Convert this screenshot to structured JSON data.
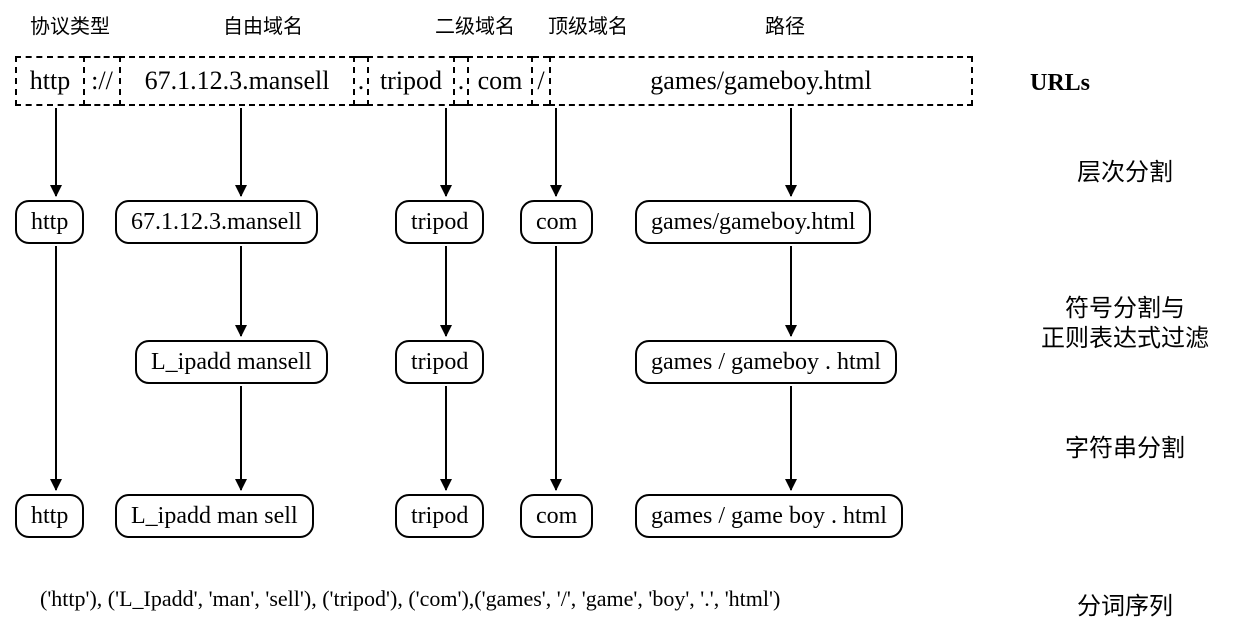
{
  "headers": {
    "protocol": "协议类型",
    "freedomain": "自由域名",
    "second": "二级域名",
    "top": "顶级域名",
    "path": "路径"
  },
  "url_parts": {
    "protocol": "http",
    "sep1": "://",
    "freedomain": "67.1.12.3.mansell",
    "sep2": ".",
    "second": "tripod",
    "sep3": ".",
    "top": "com",
    "sep4": "/",
    "path": "games/gameboy.html"
  },
  "sidebar": {
    "urls": "URLs",
    "level_split": "层次分割",
    "symbol_split_l1": "符号分割与",
    "symbol_split_l2": "正则表达式过滤",
    "string_split": "字符串分割",
    "token_seq": "分词序列"
  },
  "row1": {
    "c1": "http",
    "c2": "67.1.12.3.mansell",
    "c3": "tripod",
    "c4": "com",
    "c5": "games/gameboy.html"
  },
  "row2": {
    "c2": "L_ipadd  mansell",
    "c3": "tripod",
    "c5": "games / gameboy . html"
  },
  "row3": {
    "c1": "http",
    "c2": "L_ipadd  man sell",
    "c3": "tripod",
    "c4": "com",
    "c5": "games / game boy . html"
  },
  "tuple": "('http'), ('L_Ipadd', 'man', 'sell'), ('tripod'), ('com'),('games', '/', 'game', 'boy', '.', 'html')"
}
